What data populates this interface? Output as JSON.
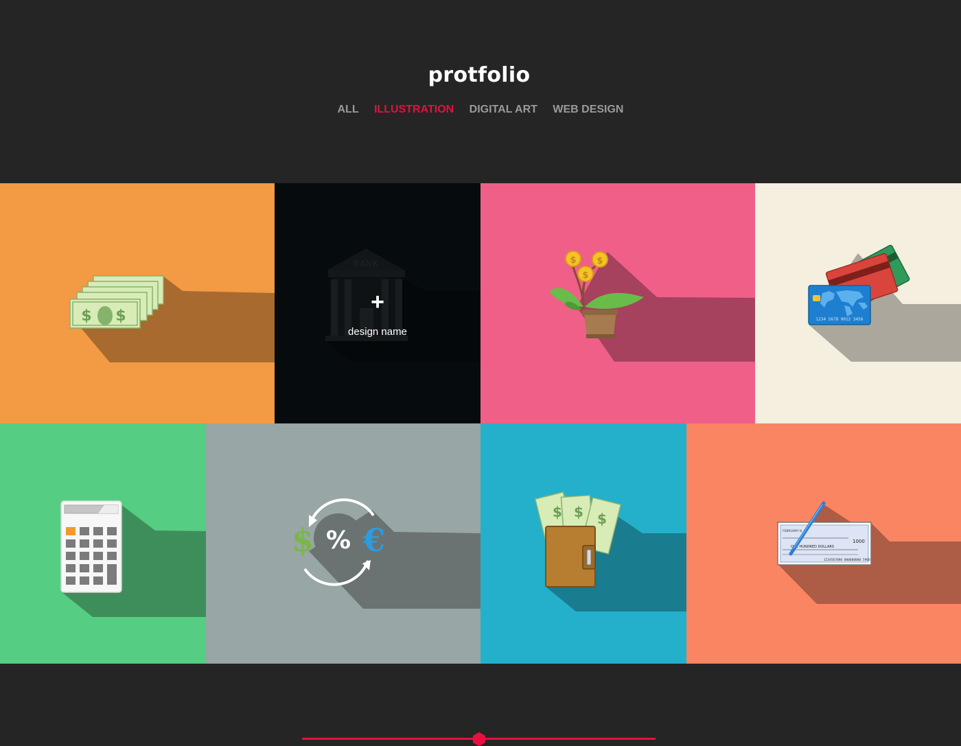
{
  "page": {
    "title": "protfolio"
  },
  "nav": {
    "items": [
      {
        "label": "ALL",
        "active": false
      },
      {
        "label": "ILLUSTRATION",
        "active": true
      },
      {
        "label": "DIGITAL ART",
        "active": false
      },
      {
        "label": "WEB DESIGN",
        "active": false
      }
    ]
  },
  "colors": {
    "background": "#252525",
    "accent": "#e6103f",
    "nav_inactive": "#9a9a9a"
  },
  "grid": {
    "tiles": [
      {
        "icon": "banknotes-icon",
        "bg": "#f29a44",
        "bill_text": "$"
      },
      {
        "icon": "bank-building-icon",
        "bg": "#060b0e",
        "building_text": "BANK",
        "hover_icon": "+",
        "hover_label": "design name"
      },
      {
        "icon": "money-plant-icon",
        "bg": "#ef5f88",
        "coin_text": "$"
      },
      {
        "icon": "credit-cards-icon",
        "bg": "#f5efdf",
        "card_number": "1234 5678 9012 3456"
      },
      {
        "icon": "calculator-icon",
        "bg": "#55cd82"
      },
      {
        "icon": "currency-exchange-icon",
        "bg": "#98a6a5",
        "symbols": [
          "$",
          "%",
          "€"
        ]
      },
      {
        "icon": "wallet-icon",
        "bg": "#24b0cb"
      },
      {
        "icon": "bank-check-icon",
        "bg": "#f98563",
        "check": {
          "date_label": "FEBRUARY 8, 20",
          "amount": "1000",
          "amount_words": "ONE HUNDRED DOLLARS",
          "numbers": "1234567890  000000000  5968"
        }
      }
    ]
  }
}
